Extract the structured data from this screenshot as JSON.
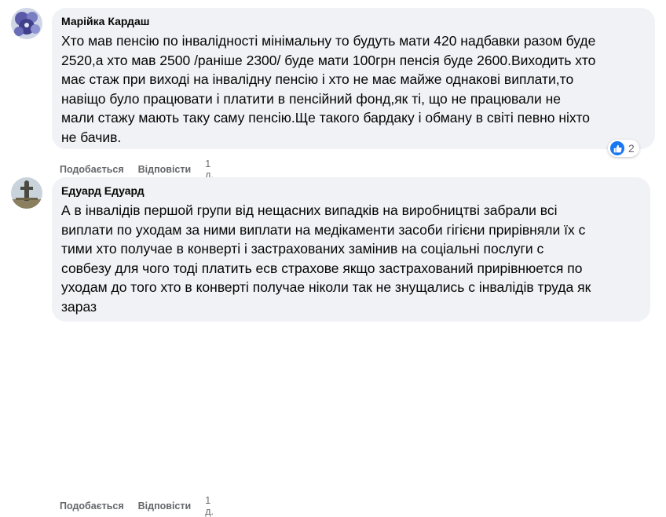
{
  "comments": [
    {
      "author": "Марійка Кардаш",
      "avatar_icon": "flower-avatar",
      "lines": [
        "Хто мав пенсію по інвалідності мінімальну то будуть мати 420 надбавки разом буде",
        "2520,а хто мав 2500 /раніше 2300/ буде мати 100грн пенсія буде 2600.Виходить хто",
        "має стаж при виході на інвалідну пенсію і хто не має майже однакові виплати,то",
        "навіщо було працювати і платити в пенсійний фонд,як ті, що не працювали не",
        "мали стажу мають таку саму пенсію.Ще такого бардаку і обману в світі певно ніхто",
        "не бачив."
      ],
      "like_label": "Подобається",
      "reply_label": "Відповісти",
      "time": "1 д.",
      "reaction_icon": "like-icon",
      "reaction_count": "2"
    },
    {
      "author": "Едуард Едуард",
      "avatar_icon": "statue-avatar",
      "lines": [
        "А в інвалідів першой групи від нещасних випадків на виробництві забрали всі",
        "виплати по уходам за ними виплати на медікаменти засоби гігієни прирівняли їх с",
        "тими хто получае в конверті і застрахованих замінив на соціальні послуги с",
        "совбезу для чого тоді платить есв страхове якщо застрахований прирівнюется по",
        "уходам до того хто в конверті получае ніколи так не знущались с інвалідів труда як",
        "зараз"
      ],
      "like_label": "Подобається",
      "reply_label": "Відповісти",
      "time": "1 д."
    }
  ],
  "colors": {
    "bubble": "#f0f2f5",
    "action_text": "#65676b",
    "like_blue": "#1877f2"
  }
}
